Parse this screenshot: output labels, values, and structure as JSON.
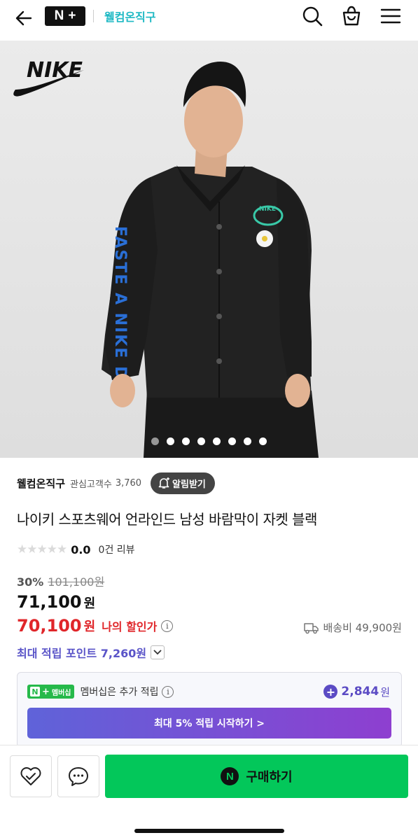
{
  "header": {
    "badge_n": "N",
    "badge_plus": "+",
    "store_name": "웰컴온직구"
  },
  "hero": {
    "brand_logo": "NIKE",
    "dot_count": 8
  },
  "store": {
    "name": "웰컴온직구",
    "fans_label": "관심고객수",
    "fans_count": "3,760",
    "alarm_label": "알림받기"
  },
  "product": {
    "title": "나이키 스포츠웨어 언라인드 남성 바람막이 자켓 블랙",
    "stars": "★★★★★",
    "rating": "0.0",
    "review_label": "0건 리뷰",
    "discount_pct": "30%",
    "original_price": "101,100원",
    "price": "71,100",
    "price_unit": "원",
    "my_price": "70,100",
    "my_price_unit": "원",
    "my_price_label": "나의 할인가",
    "shipping": "배송비 49,900원",
    "max_points": "최대 적립 포인트 7,260원"
  },
  "membership": {
    "badge_n": "N",
    "badge_plus": "+",
    "badge_label": "멤버십",
    "text": "멤버십은 추가 적립",
    "plus_sign": "+",
    "points": "2,844",
    "points_unit": "원",
    "cta": "최대 5% 적립 시작하기 >"
  },
  "bottom_bar": {
    "buy_logo": "N",
    "buy_label": "구매하기"
  },
  "colors": {
    "accent_teal": "#1fb9c4",
    "discount_red": "#e0262a",
    "points_purple": "#5a54c8",
    "buy_green": "#03c75a"
  }
}
